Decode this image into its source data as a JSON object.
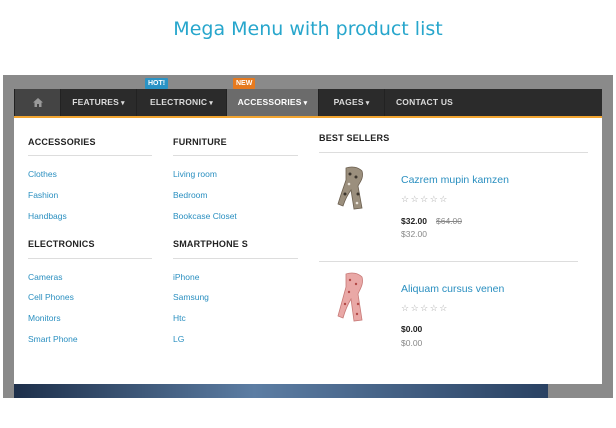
{
  "heading": "Mega Menu with product list",
  "nav": {
    "home_icon": "home-icon",
    "items": [
      {
        "label": "FEATURES",
        "caret": "▾"
      },
      {
        "label": "ELECTRONIC",
        "caret": "▾",
        "badge": "HOT!"
      },
      {
        "label": "ACCESSORIES",
        "caret": "▾",
        "badge": "NEW",
        "active": true
      },
      {
        "label": "PAGES",
        "caret": "▾"
      },
      {
        "label": "CONTACT US"
      }
    ]
  },
  "menu": {
    "columns": [
      {
        "title": "ACCESSORIES",
        "links": [
          "Clothes",
          "Fashion",
          "Handbags"
        ]
      },
      {
        "title": "FURNITURE",
        "links": [
          "Living room",
          "Bedroom",
          "Bookcase Closet"
        ]
      },
      {
        "title": "ELECTRONICS",
        "links": [
          "Cameras",
          "Cell Phones",
          "Monitors",
          "Smart Phone"
        ]
      },
      {
        "title": "SMARTPHONE S",
        "links": [
          "iPhone",
          "Samsung",
          "Htc",
          "LG"
        ]
      }
    ],
    "best_sellers": {
      "title": "BEST SELLERS",
      "products": [
        {
          "name": "Cazrem mupin kamzen",
          "stars": "☆☆☆☆☆",
          "price": "$32.00",
          "old_price": "$64.00",
          "sub_price": "$32.00"
        },
        {
          "name": "Aliquam cursus venen",
          "stars": "☆☆☆☆☆",
          "price": "$0.00",
          "sub_price": "$0.00"
        }
      ]
    }
  },
  "colors": {
    "accent": "#27a6cc",
    "nav_bg": "#2b2b2b",
    "active_tab": "#6b6b6b",
    "underline": "#f2a531",
    "badge_hot": "#2a93c5",
    "badge_new": "#e67a1f",
    "link": "#2a8fc0"
  }
}
